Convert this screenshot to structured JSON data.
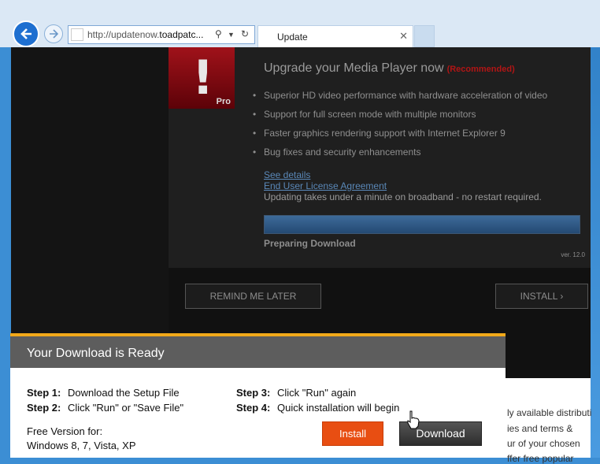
{
  "browser": {
    "address_url_prefix": "http://updatenow.",
    "address_url_domain": "toadpatc...",
    "tab_title": "Update"
  },
  "ad": {
    "logo_label": "Pro",
    "headline": "Upgrade your Media Player now",
    "recommended": "(Recommended)",
    "features": [
      "Superior HD video performance with hardware acceleration of video",
      "Support for full screen mode with multiple monitors",
      "Faster graphics rendering support with Internet Explorer 9",
      "Bug fixes and security enhancements"
    ],
    "see_details": "See details",
    "eula": "End User License Agreement",
    "note": "Updating takes under a minute on broadband - no restart required.",
    "progress": 1.0,
    "progress_label": "Preparing Download",
    "version": "ver. 12.0",
    "remind_label": "REMIND ME LATER",
    "install_label": "INSTALL ›"
  },
  "modal": {
    "title": "Your Download is Ready",
    "step1_label": "Step 1:",
    "step1_text": "Download the Setup File",
    "step2_label": "Step 2:",
    "step2_text": "Click \"Run\" or \"Save File\"",
    "step3_label": "Step 3:",
    "step3_text": "Click \"Run\" again",
    "step4_label": "Step 4:",
    "step4_text": "Quick installation will begin",
    "free_line1": "Free Version for:",
    "free_line2": "Windows 8, 7, Vista, XP",
    "install_button": "Install",
    "download_button": "Download"
  },
  "background_text": {
    "line1": "ly available distributi",
    "line2": "ies and terms &",
    "line3": "ur of your chosen",
    "line4": "ffer free popular"
  },
  "colors": {
    "accent_orange": "#e84e12",
    "modal_stripe": "#f2a91a",
    "recommended_red": "#b01515"
  }
}
